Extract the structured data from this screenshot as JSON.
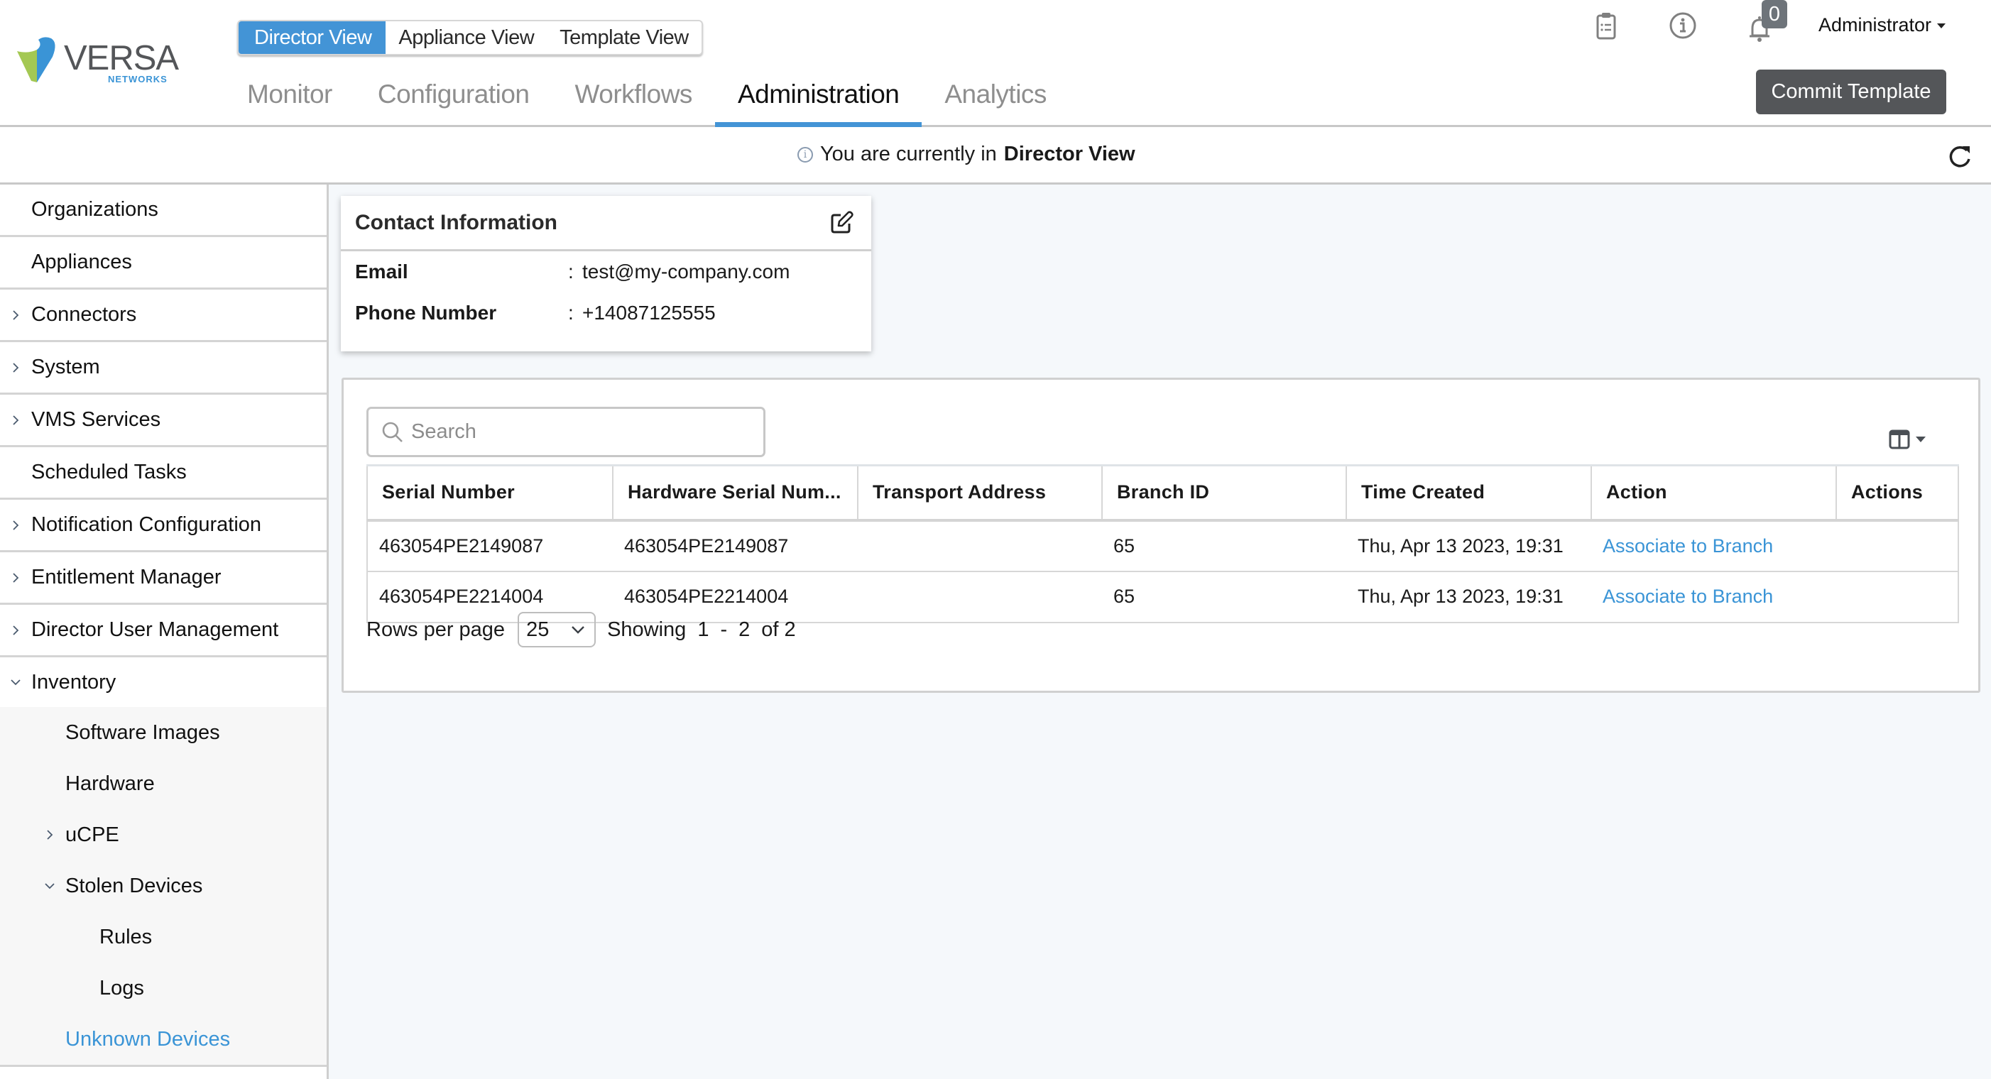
{
  "brand": {
    "word": "VERSA",
    "sub": "NETWORKS",
    "colors": {
      "blue": "#3a94d6",
      "green": "#a4c853",
      "gray": "#545659"
    }
  },
  "view_switch": [
    {
      "label": "Director View",
      "active": true
    },
    {
      "label": "Appliance View",
      "active": false
    },
    {
      "label": "Template View",
      "active": false
    }
  ],
  "nav_tabs": [
    {
      "label": "Monitor",
      "active": false
    },
    {
      "label": "Configuration",
      "active": false
    },
    {
      "label": "Workflows",
      "active": false
    },
    {
      "label": "Administration",
      "active": true
    },
    {
      "label": "Analytics",
      "active": false
    }
  ],
  "header_icons": [
    "clipboard-list-icon",
    "info-icon",
    "bell-icon"
  ],
  "notifications": {
    "count": "0"
  },
  "user": {
    "name": "Administrator"
  },
  "commit_button": "Commit Template",
  "info_bar": {
    "prefix": "You are currently in",
    "view": "Director View"
  },
  "sidebar": {
    "items": [
      {
        "label": "Organizations",
        "expandable": false
      },
      {
        "label": "Appliances",
        "expandable": false
      },
      {
        "label": "Connectors",
        "expandable": true
      },
      {
        "label": "System",
        "expandable": true
      },
      {
        "label": "VMS Services",
        "expandable": true
      },
      {
        "label": "Scheduled Tasks",
        "expandable": false
      },
      {
        "label": "Notification Configuration",
        "expandable": true
      },
      {
        "label": "Entitlement Manager",
        "expandable": true
      },
      {
        "label": "Director User Management",
        "expandable": true
      },
      {
        "label": "Inventory",
        "expandable": true,
        "expanded": true
      }
    ],
    "inventory_children": [
      {
        "label": "Software Images"
      },
      {
        "label": "Hardware"
      },
      {
        "label": "uCPE",
        "expandable": true
      },
      {
        "label": "Stolen Devices",
        "expandable": true,
        "expanded": true
      },
      {
        "label": "Rules",
        "level": 2
      },
      {
        "label": "Logs",
        "level": 2
      },
      {
        "label": "Unknown Devices",
        "active": true
      }
    ]
  },
  "contact": {
    "title": "Contact Information",
    "fields": [
      {
        "label": "Email",
        "value": "test@my-company.com"
      },
      {
        "label": "Phone Number",
        "value": "+14087125555"
      }
    ]
  },
  "table": {
    "search_placeholder": "Search",
    "columns": [
      "Serial Number",
      "Hardware Serial Num...",
      "Transport Address",
      "Branch ID",
      "Time Created",
      "Action",
      "Actions"
    ],
    "rows": [
      {
        "serial": "463054PE2149087",
        "hw_serial": "463054PE2149087",
        "transport": "",
        "branch_id": "65",
        "time_created": "Thu, Apr 13 2023, 19:31",
        "action": "Associate to Branch",
        "actions": ""
      },
      {
        "serial": "463054PE2214004",
        "hw_serial": "463054PE2214004",
        "transport": "",
        "branch_id": "65",
        "time_created": "Thu, Apr 13 2023, 19:31",
        "action": "Associate to Branch",
        "actions": ""
      }
    ]
  },
  "pagination": {
    "rows_per_page_label": "Rows per page",
    "rows_per_page": "25",
    "showing_label": "Showing",
    "from": "1",
    "dash": "-",
    "to": "2",
    "of_label": "of 2"
  }
}
